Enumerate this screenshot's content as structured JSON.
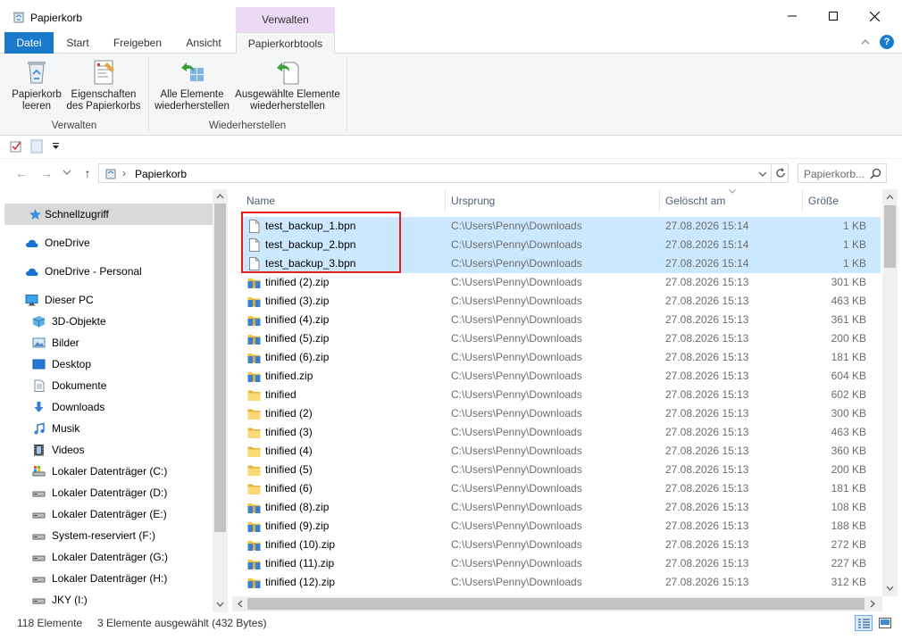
{
  "window": {
    "title": "Papierkorb",
    "context_tab_header": "Verwalten"
  },
  "ribbon": {
    "tabs": [
      "Datei",
      "Start",
      "Freigeben",
      "Ansicht",
      "Papierkorbtools"
    ],
    "active_tab": "Papierkorbtools",
    "help": "?",
    "groups": {
      "verwalten": {
        "label": "Verwalten",
        "empty_line1": "Papierkorb",
        "empty_line2": "leeren",
        "props_line1": "Eigenschaften",
        "props_line2": "des Papierkorbs"
      },
      "wiederherstellen": {
        "label": "Wiederherstellen",
        "all_line1": "Alle Elemente",
        "all_line2": "wiederherstellen",
        "sel_line1": "Ausgewählte Elemente",
        "sel_line2": "wiederherstellen"
      }
    }
  },
  "address": {
    "path": "Papierkorb",
    "search_placeholder": "Papierkorb..."
  },
  "nav": {
    "items": [
      {
        "label": "Schnellzugriff",
        "icon": "star-icon",
        "selected": true
      },
      {
        "label": "OneDrive",
        "icon": "cloud-icon"
      },
      {
        "label": "OneDrive - Personal",
        "icon": "cloud-icon"
      },
      {
        "label": "Dieser PC",
        "icon": "monitor-icon"
      },
      {
        "label": "3D-Objekte",
        "icon": "cube-icon"
      },
      {
        "label": "Bilder",
        "icon": "pictures-icon"
      },
      {
        "label": "Desktop",
        "icon": "desktop-icon"
      },
      {
        "label": "Dokumente",
        "icon": "document-icon"
      },
      {
        "label": "Downloads",
        "icon": "download-arrow-icon"
      },
      {
        "label": "Musik",
        "icon": "music-note-icon"
      },
      {
        "label": "Videos",
        "icon": "film-icon"
      },
      {
        "label": "Lokaler Datenträger (C:)",
        "icon": "system-drive-icon"
      },
      {
        "label": "Lokaler Datenträger (D:)",
        "icon": "drive-icon"
      },
      {
        "label": "Lokaler Datenträger (E:)",
        "icon": "drive-icon"
      },
      {
        "label": "System-reserviert (F:)",
        "icon": "drive-icon"
      },
      {
        "label": "Lokaler Datenträger (G:)",
        "icon": "drive-icon"
      },
      {
        "label": "Lokaler Datenträger (H:)",
        "icon": "drive-icon"
      },
      {
        "label": "JKY (I:)",
        "icon": "drive-icon"
      }
    ]
  },
  "list": {
    "columns": {
      "name": "Name",
      "origin": "Ursprung",
      "deleted": "Gelöscht am",
      "size": "Größe"
    },
    "rows": [
      {
        "name": "test_backup_1.bpn",
        "origin": "C:\\Users\\Penny\\Downloads",
        "deleted": "27.08.2026 15:14",
        "size": "1 KB",
        "icon": "file-icon",
        "selected": true
      },
      {
        "name": "test_backup_2.bpn",
        "origin": "C:\\Users\\Penny\\Downloads",
        "deleted": "27.08.2026 15:14",
        "size": "1 KB",
        "icon": "file-icon",
        "selected": true
      },
      {
        "name": "test_backup_3.bpn",
        "origin": "C:\\Users\\Penny\\Downloads",
        "deleted": "27.08.2026 15:14",
        "size": "1 KB",
        "icon": "file-icon",
        "selected": true
      },
      {
        "name": "tinified (2).zip",
        "origin": "C:\\Users\\Penny\\Downloads",
        "deleted": "27.08.2026 15:13",
        "size": "301 KB",
        "icon": "zip-folder-icon"
      },
      {
        "name": "tinified (3).zip",
        "origin": "C:\\Users\\Penny\\Downloads",
        "deleted": "27.08.2026 15:13",
        "size": "463 KB",
        "icon": "zip-folder-icon"
      },
      {
        "name": "tinified (4).zip",
        "origin": "C:\\Users\\Penny\\Downloads",
        "deleted": "27.08.2026 15:13",
        "size": "361 KB",
        "icon": "zip-folder-icon"
      },
      {
        "name": "tinified (5).zip",
        "origin": "C:\\Users\\Penny\\Downloads",
        "deleted": "27.08.2026 15:13",
        "size": "200 KB",
        "icon": "zip-folder-icon"
      },
      {
        "name": "tinified (6).zip",
        "origin": "C:\\Users\\Penny\\Downloads",
        "deleted": "27.08.2026 15:13",
        "size": "181 KB",
        "icon": "zip-folder-icon"
      },
      {
        "name": "tinified.zip",
        "origin": "C:\\Users\\Penny\\Downloads",
        "deleted": "27.08.2026 15:13",
        "size": "604 KB",
        "icon": "zip-folder-icon"
      },
      {
        "name": "tinified",
        "origin": "C:\\Users\\Penny\\Downloads",
        "deleted": "27.08.2026 15:13",
        "size": "602 KB",
        "icon": "folder-icon"
      },
      {
        "name": "tinified (2)",
        "origin": "C:\\Users\\Penny\\Downloads",
        "deleted": "27.08.2026 15:13",
        "size": "300 KB",
        "icon": "folder-icon"
      },
      {
        "name": "tinified (3)",
        "origin": "C:\\Users\\Penny\\Downloads",
        "deleted": "27.08.2026 15:13",
        "size": "463 KB",
        "icon": "folder-icon"
      },
      {
        "name": "tinified (4)",
        "origin": "C:\\Users\\Penny\\Downloads",
        "deleted": "27.08.2026 15:13",
        "size": "360 KB",
        "icon": "folder-icon"
      },
      {
        "name": "tinified (5)",
        "origin": "C:\\Users\\Penny\\Downloads",
        "deleted": "27.08.2026 15:13",
        "size": "200 KB",
        "icon": "folder-icon"
      },
      {
        "name": "tinified (6)",
        "origin": "C:\\Users\\Penny\\Downloads",
        "deleted": "27.08.2026 15:13",
        "size": "181 KB",
        "icon": "folder-icon"
      },
      {
        "name": "tinified (8).zip",
        "origin": "C:\\Users\\Penny\\Downloads",
        "deleted": "27.08.2026 15:13",
        "size": "108 KB",
        "icon": "zip-folder-icon"
      },
      {
        "name": "tinified (9).zip",
        "origin": "C:\\Users\\Penny\\Downloads",
        "deleted": "27.08.2026 15:13",
        "size": "188 KB",
        "icon": "zip-folder-icon"
      },
      {
        "name": "tinified (10).zip",
        "origin": "C:\\Users\\Penny\\Downloads",
        "deleted": "27.08.2026 15:13",
        "size": "272 KB",
        "icon": "zip-folder-icon"
      },
      {
        "name": "tinified (11).zip",
        "origin": "C:\\Users\\Penny\\Downloads",
        "deleted": "27.08.2026 15:13",
        "size": "227 KB",
        "icon": "zip-folder-icon"
      },
      {
        "name": "tinified (12).zip",
        "origin": "C:\\Users\\Penny\\Downloads",
        "deleted": "27.08.2026 15:13",
        "size": "312 KB",
        "icon": "zip-folder-icon"
      }
    ]
  },
  "status": {
    "count": "118 Elemente",
    "selection": "3 Elemente ausgewählt (432 Bytes)"
  },
  "colors": {
    "accent": "#1979ca",
    "selection": "#cce8ff",
    "context_tab": "#ecd9f5",
    "highlight_box": "#e0201c"
  }
}
